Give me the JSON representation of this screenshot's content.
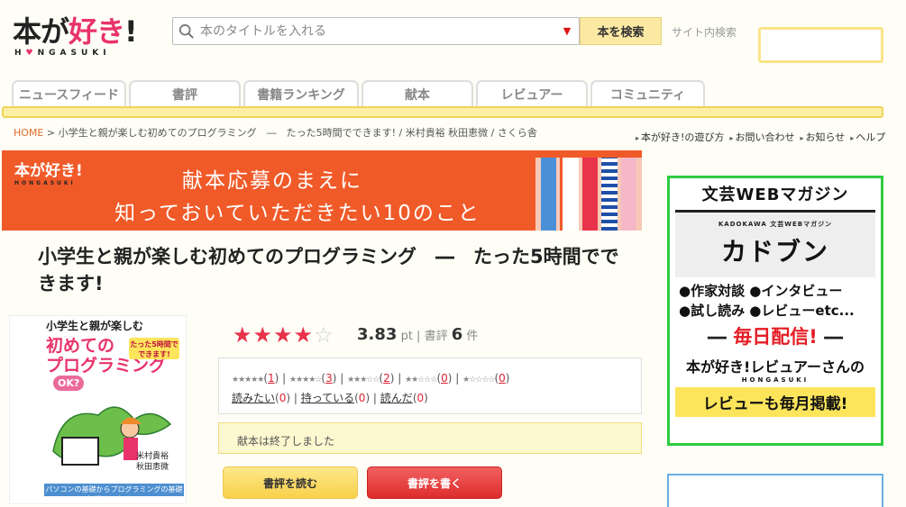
{
  "header": {
    "logo_text_a": "本が",
    "logo_text_b": "好き",
    "logo_text_c": "!",
    "logo_sub_a": "H",
    "logo_sub_b": "NGASUKI",
    "search_placeholder": "本のタイトルを入れる",
    "search_button": "本を検索",
    "site_search": "サイト内検索"
  },
  "nav": {
    "tabs": [
      {
        "label": "ニュースフィード",
        "width": 127
      },
      {
        "label": "書評",
        "width": 124
      },
      {
        "label": "書籍ランキング",
        "width": 128
      },
      {
        "label": "献本",
        "width": 124
      },
      {
        "label": "レビュアー",
        "width": 124
      },
      {
        "label": "コミュニティ",
        "width": 127
      }
    ]
  },
  "breadcrumb": {
    "home": "HOME",
    "rest": " > 小学生と親が楽しむ初めてのプログラミング　―　たった5時間でできます! / 米村貴裕 秋田恵微 / さくら舎"
  },
  "toplinks": [
    "本が好き!の遊び方",
    "お問い合わせ",
    "お知らせ",
    "ヘルプ"
  ],
  "banner": {
    "logo": "本が好き!",
    "logo_sub": "HONGASUKI",
    "line1": "献本応募のまえに",
    "line2": "知っておいていただきたい10のこと"
  },
  "book": {
    "title": "小学生と親が楽しむ初めてのプログラミング　―　たった5時間でできます!",
    "cover_top": "小学生と親が楽しむ",
    "cover_main1": "初めての",
    "cover_main2": "プログラミング",
    "cover_badge": "たった5時間で できます!",
    "cover_ok": "OK?",
    "cover_author": "米村貴裕\n秋田恵微",
    "cover_bottom": "パソコンの基礎からプログラミングの基礎知識までカバー!"
  },
  "rating": {
    "stars_filled": 4,
    "stars_total": 5,
    "score": "3.83",
    "score_unit": "pt",
    "review_label": "書評",
    "review_count": "6",
    "review_unit": "件"
  },
  "rating_breakdown": {
    "s5": "★★★★★",
    "c5": "1",
    "s4": "★★★★☆",
    "c4": "3",
    "s3": "★★★☆☆",
    "c3": "2",
    "s2": "★★☆☆☆",
    "c2": "0",
    "s1": "★☆☆☆☆",
    "c1": "0",
    "want": "読みたい",
    "want_count": "0",
    "have": "持っている",
    "have_count": "0",
    "read": "読んだ",
    "read_count": "0"
  },
  "status": {
    "closed": "献本は終了しました"
  },
  "actions": {
    "read_reviews": "書評を読む",
    "write_review": "書評を書く"
  },
  "sidebar_ad": {
    "title": "文芸WEBマガジン",
    "kadokawa_sub": "KADOKAWA 文芸WEBマガジン",
    "kadokawa_name": "カドブン",
    "item1": "●作家対談 ●インタビュー",
    "item2": "●試し読み ●レビューetc...",
    "monthly": "毎日配信!",
    "reviewer": "本が好き!レビュアーさんの",
    "reviewer_sub": "HONGASUKI",
    "monthly2": "レビューも毎月掲載!"
  },
  "colors": {
    "accent_pink": "#e8336b",
    "banner_orange": "#f05a28",
    "nav_yellow": "#fcf0a5",
    "star_red": "#e8334b",
    "ad_green": "#2ecc40"
  }
}
